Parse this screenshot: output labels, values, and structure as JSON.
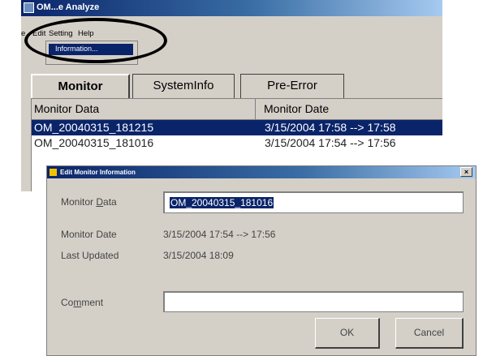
{
  "main_window": {
    "title": "OM...e Analyze",
    "menu": [
      "Edit",
      "Setting",
      "Help"
    ],
    "dropdown_selected": "Information...",
    "tabs": [
      {
        "label": "Monitor",
        "active": true
      },
      {
        "label": "SystemInfo",
        "active": false
      },
      {
        "label": "Pre-Error",
        "active": false
      }
    ],
    "columns": [
      "Monitor Data",
      "Monitor Date"
    ],
    "rows": [
      {
        "data": "OM_20040315_181215",
        "date": "3/15/2004 17:58 --> 17:58",
        "selected": true
      },
      {
        "data": "OM_20040315_181016",
        "date": "3/15/2004 17:54 --> 17:56",
        "selected": false
      }
    ]
  },
  "dialog": {
    "title": "Edit Monitor Information",
    "close_glyph": "×",
    "monitor_data_label": [
      "Monitor ",
      "D",
      "ata"
    ],
    "monitor_data_value": "OM_20040315_181016",
    "monitor_date_label": "Monitor Date",
    "monitor_date_value": "3/15/2004 17:54 --> 17:56",
    "last_updated_label": "Last Updated",
    "last_updated_value": "3/15/2004 18:09",
    "comment_label": [
      "Co",
      "m",
      "ment"
    ],
    "comment_value": "",
    "ok_label": "OK",
    "cancel_label": "Cancel"
  }
}
